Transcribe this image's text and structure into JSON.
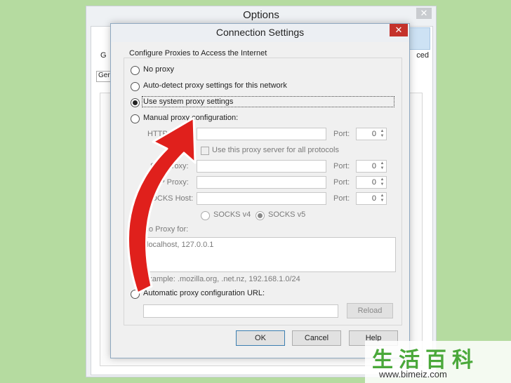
{
  "options": {
    "title": "Options",
    "close_label": "✕",
    "tab_left_label": "G",
    "tab_right_label": "ced",
    "subtab_label": "Ger"
  },
  "dialog": {
    "title": "Connection Settings",
    "close_label": "✕",
    "group_label": "Configure Proxies to Access the Internet",
    "radios": {
      "no_proxy": "No proxy",
      "auto_detect": "Auto-detect proxy settings for this network",
      "use_system": "Use system proxy settings",
      "manual": "Manual proxy configuration:",
      "auto_url": "Automatic proxy configuration URL:"
    },
    "selected_option": "use_system",
    "http_proxy_label": "HTTP Proxy:",
    "ssl_proxy_label": "SSL Proxy:",
    "ftp_proxy_label": "FTP Proxy:",
    "socks_host_label": "SOCKS Host:",
    "port_label": "Port:",
    "port_values": [
      "0",
      "0",
      "0",
      "0"
    ],
    "use_for_all_label": "Use this proxy server for all protocols",
    "socks_v4_label": "SOCKS v4",
    "socks_v5_label": "SOCKS v5",
    "no_proxy_for_label": "No Proxy for:",
    "no_proxy_for_value": "localhost, 127.0.0.1",
    "example_text": "Example: .mozilla.org, .net.nz, 192.168.1.0/24",
    "reload_label": "Reload",
    "ok_label": "OK",
    "cancel_label": "Cancel",
    "help_label": "Help"
  },
  "watermark": {
    "chinese_text": "生活百科",
    "url": "www.bimeiz.com"
  },
  "colors": {
    "background": "#b5dba0",
    "arrow_red": "#e0201c",
    "dialog_close_red": "#c4322b"
  }
}
